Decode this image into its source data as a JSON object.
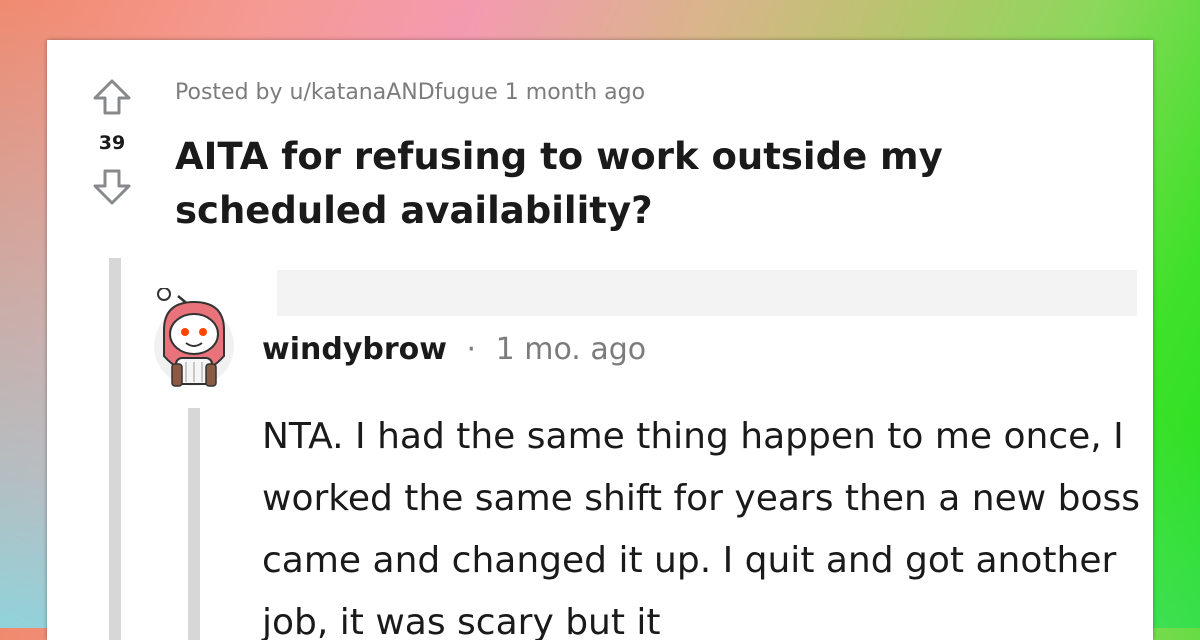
{
  "post": {
    "meta": "Posted by u/katanaANDfugue 1 month ago",
    "score": "39",
    "title": "AITA for refusing to work outside my scheduled availability?"
  },
  "comment": {
    "author": "windybrow",
    "separator": "·",
    "time": "1 mo. ago",
    "body": "NTA. I had the same thing happen to me once, I worked the same shift for years then a new boss came and changed it up. I quit and got another job, it was scary but it"
  },
  "icons": {
    "upvote": "upvote-arrow-icon",
    "downvote": "downvote-arrow-icon",
    "avatar": "snoo-avatar-icon"
  },
  "colors": {
    "text": "#1a1a1b",
    "meta": "#7c7c7c",
    "thread_line": "#d7d7d7",
    "avatar_hood": "#e8737a"
  }
}
